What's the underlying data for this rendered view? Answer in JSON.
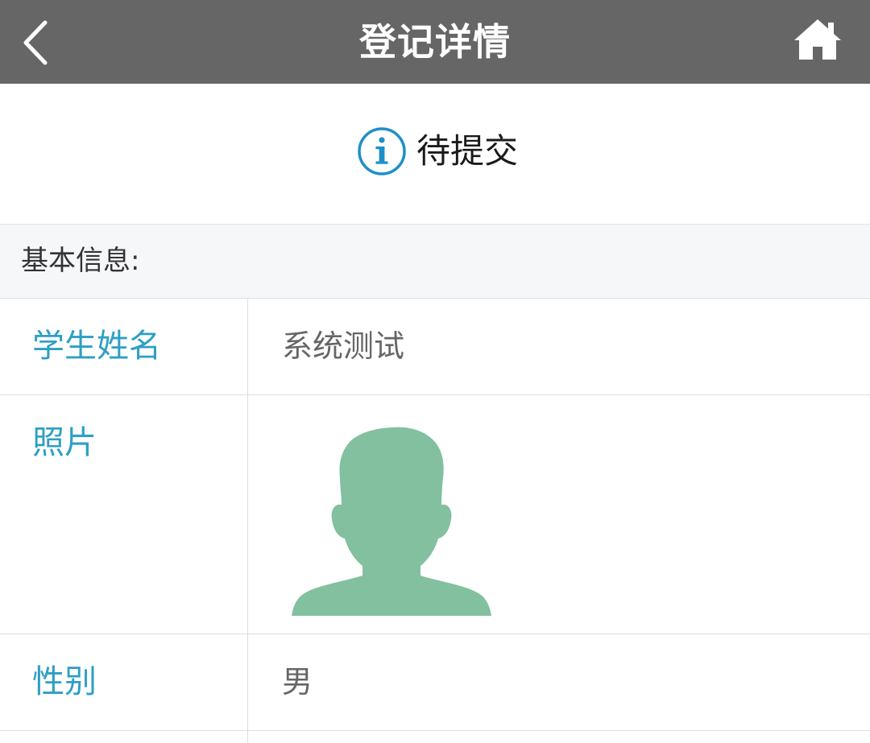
{
  "header": {
    "title": "登记详情",
    "back_icon": "chevron-left-icon",
    "home_icon": "home-icon"
  },
  "status": {
    "icon": "info-icon",
    "text": "待提交",
    "icon_color": "#1e8fc8"
  },
  "section": {
    "title": "基本信息:"
  },
  "fields": [
    {
      "label": "学生姓名",
      "value": "系统测试"
    },
    {
      "label": "照片",
      "value_icon": "avatar-placeholder-icon"
    },
    {
      "label": "性别",
      "value": "男"
    }
  ],
  "colors": {
    "header_bg": "#666666",
    "label": "#2d9fc4",
    "value": "#666666",
    "avatar": "#82c09f",
    "section_bg": "#f6f7f9",
    "divider": "#dcdfe3"
  }
}
